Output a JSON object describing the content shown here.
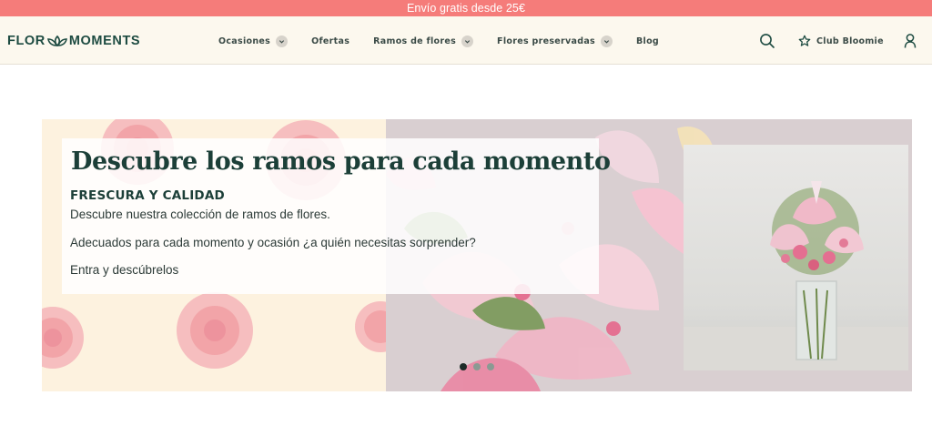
{
  "promo": {
    "text": "Envío gratis desde 25€"
  },
  "header": {
    "logo_left": "FLOR",
    "logo_right": "MOMENTS",
    "nav": [
      {
        "label": "Ocasiones",
        "has_dropdown": true
      },
      {
        "label": "Ofertas",
        "has_dropdown": false
      },
      {
        "label": "Ramos de flores",
        "has_dropdown": true
      },
      {
        "label": "Flores preservadas",
        "has_dropdown": true
      },
      {
        "label": "Blog",
        "has_dropdown": false
      }
    ],
    "search_icon": "search-icon",
    "club_icon": "star-icon",
    "club_label": "Club Bloomie",
    "account_icon": "user-icon"
  },
  "hero": {
    "title": "Descubre los ramos para cada momento",
    "subtitle": "FRESCURA Y CALIDAD",
    "line1": "Descubre nuestra colección de ramos de flores.",
    "line2": "Adecuados para cada momento y ocasión ¿a quién necesitas sorprender?",
    "cta": "Entra y descúbrelos",
    "slides": 3,
    "active_slide": 1
  },
  "colors": {
    "promo_bg": "#f57c7a",
    "header_bg": "#fcf8ee",
    "brand_green": "#1d4b41",
    "pattern_pink": "#f09aa2",
    "lily_pink": "#e8638a"
  }
}
